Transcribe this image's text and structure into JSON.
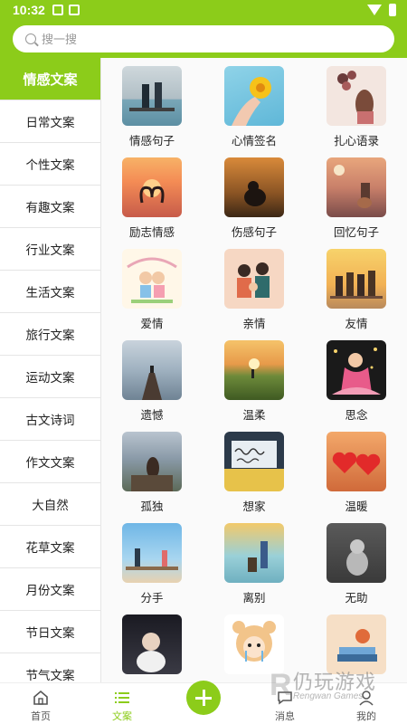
{
  "status": {
    "time": "10:32"
  },
  "search": {
    "placeholder": "搜一搜"
  },
  "sidebar": {
    "items": [
      {
        "label": "情感文案"
      },
      {
        "label": "日常文案"
      },
      {
        "label": "个性文案"
      },
      {
        "label": "有趣文案"
      },
      {
        "label": "行业文案"
      },
      {
        "label": "生活文案"
      },
      {
        "label": "旅行文案"
      },
      {
        "label": "运动文案"
      },
      {
        "label": "古文诗词"
      },
      {
        "label": "作文文案"
      },
      {
        "label": "大自然"
      },
      {
        "label": "花草文案"
      },
      {
        "label": "月份文案"
      },
      {
        "label": "节日文案"
      },
      {
        "label": "节气文案"
      }
    ]
  },
  "grid": {
    "items": [
      {
        "label": "情感句子",
        "thumb": "couple-on-pier-photo"
      },
      {
        "label": "心情签名",
        "thumb": "hand-holding-flower-photo"
      },
      {
        "label": "扎心语录",
        "thumb": "girl-with-balloons-illustration"
      },
      {
        "label": "励志情感",
        "thumb": "swans-heart-sunset-photo"
      },
      {
        "label": "伤感句子",
        "thumb": "sad-person-sitting-photo"
      },
      {
        "label": "回忆句子",
        "thumb": "girl-guitar-sunset-illustration"
      },
      {
        "label": "爱情",
        "thumb": "cartoon-couple-illustration"
      },
      {
        "label": "亲情",
        "thumb": "family-illustration"
      },
      {
        "label": "友情",
        "thumb": "friends-cheering-illustration"
      },
      {
        "label": "遗憾",
        "thumb": "pier-lake-photo"
      },
      {
        "label": "温柔",
        "thumb": "sunset-hill-photo"
      },
      {
        "label": "思念",
        "thumb": "fairy-girl-illustration"
      },
      {
        "label": "孤独",
        "thumb": "girl-on-rock-photo"
      },
      {
        "label": "想家",
        "thumb": "handwriting-card-photo"
      },
      {
        "label": "温暖",
        "thumb": "two-hearts-photo"
      },
      {
        "label": "分手",
        "thumb": "couple-apart-illustration"
      },
      {
        "label": "离别",
        "thumb": "girl-with-suitcase-illustration"
      },
      {
        "label": "无助",
        "thumb": "dog-sitting-photo"
      },
      {
        "label": "",
        "thumb": "crying-girl-photo"
      },
      {
        "label": "",
        "thumb": "bear-hood-cartoon"
      },
      {
        "label": "",
        "thumb": "sleeping-girl-illustration"
      }
    ]
  },
  "bottom_nav": {
    "items": [
      {
        "label": "首页",
        "icon": "home-icon"
      },
      {
        "label": "文案",
        "icon": "list-icon"
      },
      {
        "label": "",
        "icon": "plus-icon"
      },
      {
        "label": "消息",
        "icon": "message-icon"
      },
      {
        "label": "我的",
        "icon": "user-icon"
      }
    ]
  },
  "watermark": {
    "cn": "仍玩游戏",
    "en": "Rengwan Games"
  },
  "colors": {
    "accent": "#8ccc1a"
  }
}
